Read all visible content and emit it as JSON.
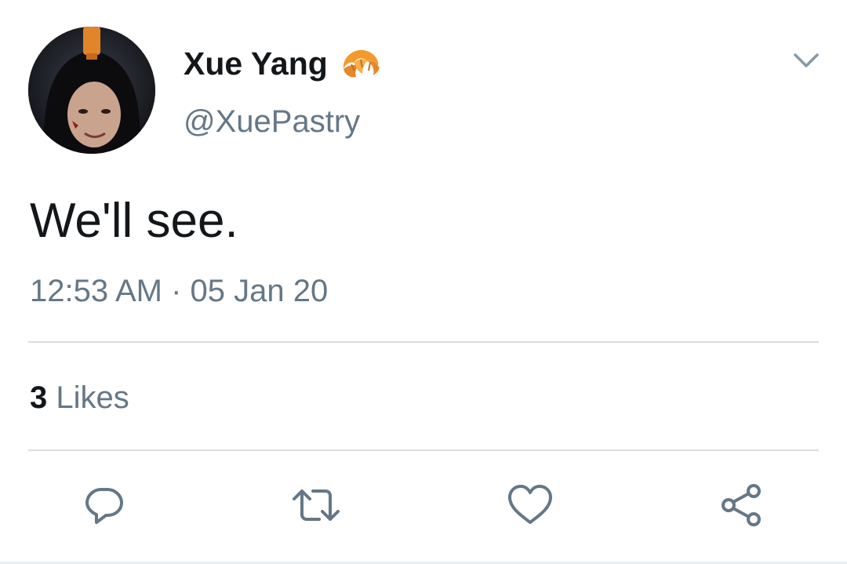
{
  "author": {
    "display_name": "Xue Yang",
    "handle": "@XuePastry",
    "name_emoji": "croissant-icon"
  },
  "tweet": {
    "text": "We'll see.",
    "timestamp": "12:53 AM · 05 Jan 20"
  },
  "stats": {
    "likes_count": "3",
    "likes_label": "Likes"
  },
  "actions": [
    "reply-icon",
    "retweet-icon",
    "like-icon",
    "share-icon"
  ],
  "colors": {
    "text_primary": "#14171a",
    "text_secondary": "#657786",
    "icon": "#657786",
    "divider": "#d9dee2",
    "croissant": "#f29a2e"
  }
}
